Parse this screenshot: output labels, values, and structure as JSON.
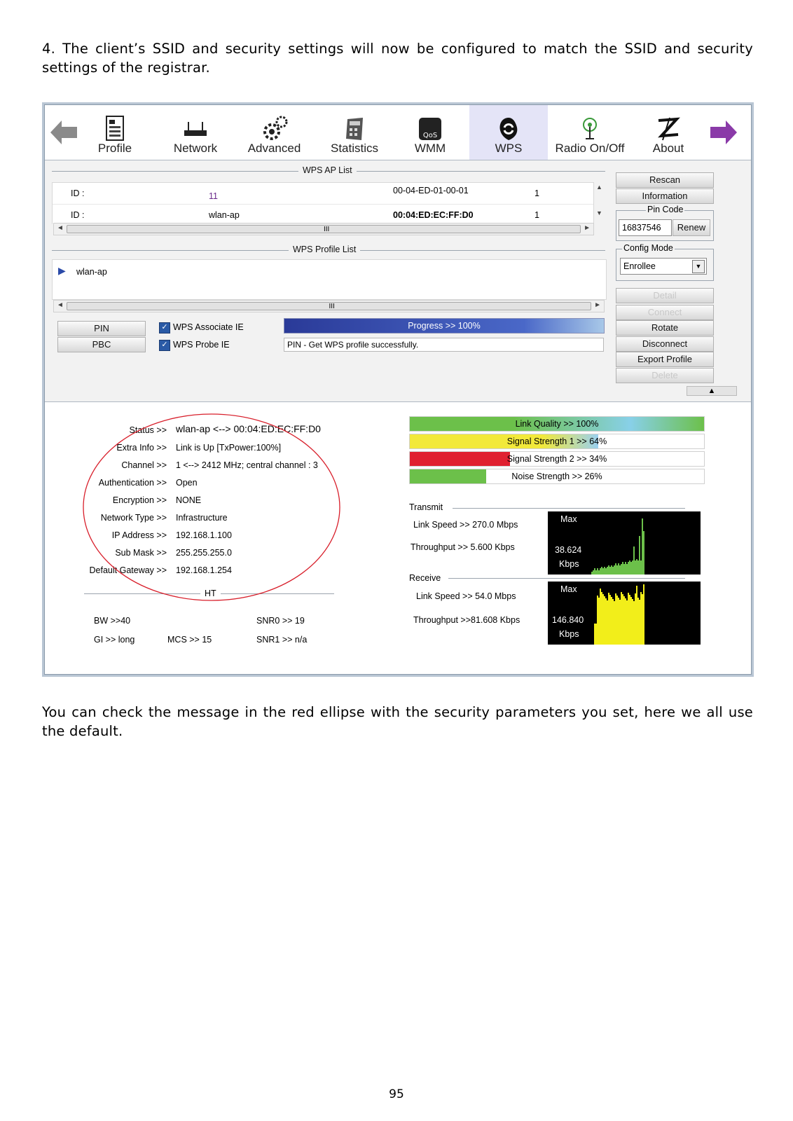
{
  "doc": {
    "para_top": "4. The client’s SSID and security settings will now be configured to match the SSID and security settings of the registrar.",
    "para_bottom": "You can check the message in the red ellipse with the security parameters you set, here we all use the default.",
    "page_number": "95"
  },
  "toolbar": {
    "items": [
      "Profile",
      "Network",
      "Advanced",
      "Statistics",
      "WMM",
      "WPS",
      "Radio On/Off",
      "About"
    ],
    "active": "WPS"
  },
  "ap_list": {
    "title": "WPS AP List",
    "rows": [
      {
        "id_label": "ID :",
        "name": "11",
        "bssid": "00-04-ED-01-00-01",
        "ch": "1"
      },
      {
        "id_label": "ID :",
        "name": "wlan-ap",
        "bssid": "00:04:ED:EC:FF:D0",
        "ch": "1"
      }
    ]
  },
  "profile_list": {
    "title": "WPS Profile List",
    "items": [
      "wlan-ap"
    ]
  },
  "side_buttons": {
    "rescan": "Rescan",
    "information": "Information",
    "pin_code_label": "Pin Code",
    "pin_code": "16837546",
    "renew": "Renew",
    "config_mode_label": "Config Mode",
    "config_mode": "Enrollee",
    "detail": "Detail",
    "connect": "Connect",
    "rotate": "Rotate",
    "disconnect": "Disconnect",
    "export_profile": "Export Profile",
    "delete": "Delete"
  },
  "wps_controls": {
    "pin": "PIN",
    "pbc": "PBC",
    "associate_ie": "WPS Associate IE",
    "probe_ie": "WPS Probe IE",
    "progress_text": "Progress >> 100%",
    "progress": 1.0,
    "status_msg": "PIN - Get WPS profile successfully."
  },
  "status": {
    "rows": [
      {
        "k": "Status >>",
        "v": "wlan-ap  <-->  00:04:ED:EC:FF:D0"
      },
      {
        "k": "Extra Info >>",
        "v": "Link is Up [TxPower:100%]"
      },
      {
        "k": "Channel >>",
        "v": "1 <--> 2412 MHz; central channel : 3"
      },
      {
        "k": "Authentication >>",
        "v": "Open"
      },
      {
        "k": "Encryption >>",
        "v": "NONE"
      },
      {
        "k": "Network Type >>",
        "v": "Infrastructure"
      },
      {
        "k": "IP Address >>",
        "v": "192.168.1.100"
      },
      {
        "k": "Sub Mask >>",
        "v": "255.255.255.0"
      },
      {
        "k": "Default Gateway >>",
        "v": "192.168.1.254"
      }
    ],
    "ht_title": "HT",
    "bw": "BW >>40",
    "gi": "GI >> long",
    "mcs": "MCS >>   15",
    "snr0": "SNR0 >>   19",
    "snr1": "SNR1 >>  n/a"
  },
  "signal": {
    "link_quality": {
      "text": "Link Quality >> 100%",
      "value": 1.0
    },
    "signal1": {
      "text": "Signal Strength 1 >> 64%",
      "value": 0.64
    },
    "signal2": {
      "text": "Signal Strength 2 >> 34%",
      "value": 0.34
    },
    "noise": {
      "text": "Noise Strength >> 26%",
      "value": 0.26
    }
  },
  "transmit": {
    "title": "Transmit",
    "link_speed": "Link Speed >>  270.0 Mbps",
    "throughput": "Throughput >> 5.600 Kbps",
    "max": "Max",
    "value": "38.624",
    "unit": "Kbps"
  },
  "receive": {
    "title": "Receive",
    "link_speed": "Link Speed >> 54.0 Mbps",
    "throughput": "Throughput >>81.608 Kbps",
    "max": "Max",
    "value": "146.840",
    "unit": "Kbps"
  },
  "colors": {
    "progress_blue": "#3848a8",
    "link_quality": "#6cc04a",
    "signal_yellow": "#f2e93a",
    "signal_red": "#e02030",
    "noise_green": "#6cc04a",
    "tx_graph": "#6cc04a",
    "rx_graph": "#f2ee1a",
    "ellipse": "#d81e2a"
  }
}
